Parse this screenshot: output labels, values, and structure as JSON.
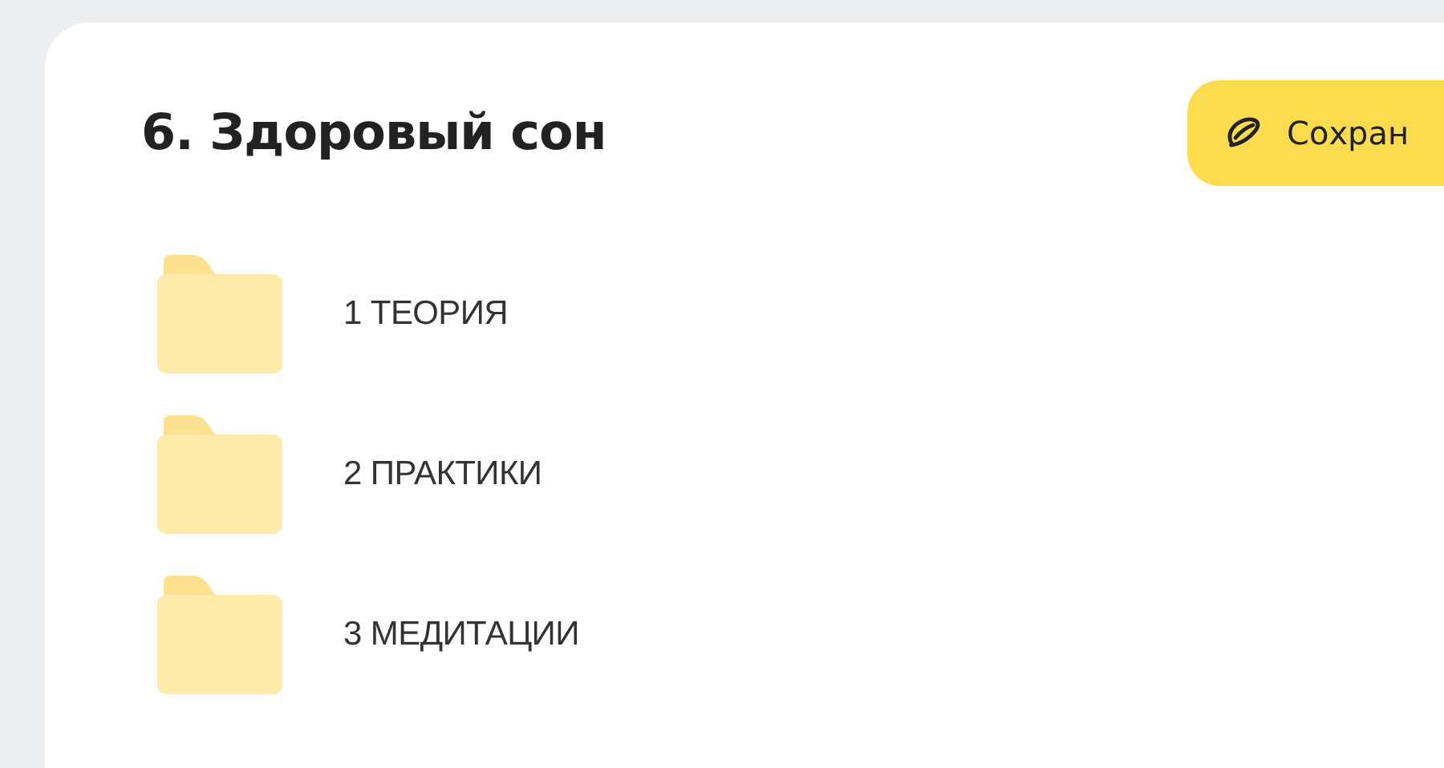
{
  "header": {
    "title": "6. Здоровый сон",
    "save_button": "Сохран"
  },
  "folders": [
    {
      "name": "1 ТЕОРИЯ"
    },
    {
      "name": "2 ПРАКТИКИ"
    },
    {
      "name": "3 МЕДИТАЦИИ"
    }
  ]
}
